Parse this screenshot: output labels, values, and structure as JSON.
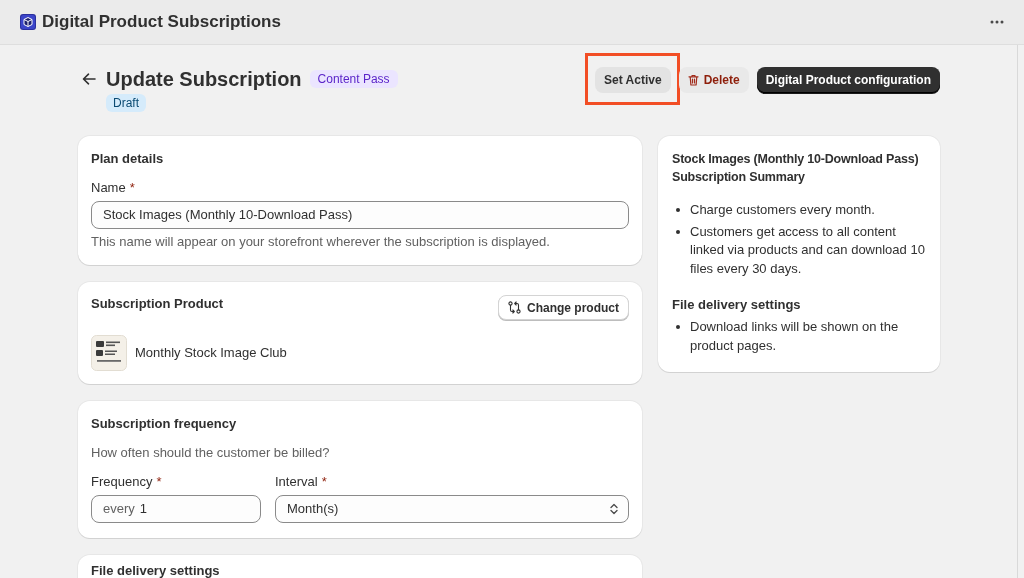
{
  "app_bar": {
    "title": "Digital Product Subscriptions"
  },
  "header": {
    "title": "Update Subscription",
    "tag": "Content Pass",
    "status": "Draft",
    "actions": [
      {
        "label": "Set Active",
        "kind": "secondary",
        "highlighted": true
      },
      {
        "label": "Delete",
        "kind": "critical",
        "highlighted": false
      },
      {
        "label": "Digital Product configuration",
        "kind": "primary",
        "highlighted": false
      }
    ]
  },
  "plan_details": {
    "title": "Plan details",
    "field": {
      "label": "Name",
      "required_mark": "*",
      "value": "Stock Images (Monthly 10-Download Pass)",
      "help": "This name will appear on your storefront wherever the subscription is displayed."
    }
  },
  "subscription_product": {
    "title": "Subscription Product",
    "button": "Change product",
    "product": {
      "name": "Monthly Stock Image Club"
    }
  },
  "subscription_frequency": {
    "title": "Subscription frequency",
    "description": "How often should the customer be billed?",
    "fields": [
      {
        "kind": "text",
        "label": "Frequency",
        "required_mark": "*",
        "prefix": "every",
        "value": "1"
      },
      {
        "kind": "select",
        "label": "Interval",
        "required_mark": "*",
        "value": "Month(s)"
      }
    ]
  },
  "file_delivery_settings": {
    "title": "File delivery settings"
  },
  "summary": {
    "title_lines": [
      "Stock Images (Monthly 10-Download Pass)",
      "Subscription Summary"
    ],
    "sections": [
      {
        "items": [
          "Charge customers every month.",
          "Customers get access to all content linked via products and can download 10 files every 30 days."
        ]
      },
      {
        "title": "File delivery settings",
        "items": [
          "Download links will be shown on the product pages."
        ]
      }
    ]
  }
}
